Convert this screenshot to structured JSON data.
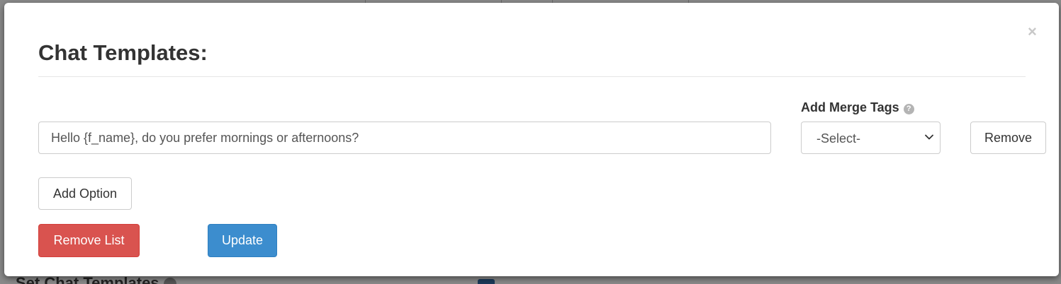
{
  "modal": {
    "title": "Chat Templates:",
    "close_label": "×",
    "merge_tags": {
      "label": "Add Merge Tags",
      "help_icon": "?",
      "select_value": "-Select-"
    },
    "option_input": {
      "value": "Hello {f_name}, do you prefer mornings or afternoons?"
    },
    "remove_label": "Remove",
    "add_option_label": "Add Option",
    "remove_list_label": "Remove List",
    "update_label": "Update"
  },
  "background": {
    "section_heading": "Set Chat Templates"
  },
  "colors": {
    "danger": "#d9534f",
    "primary": "#3c8dce",
    "overlay": "#8a8a8a"
  },
  "icons": {
    "close": "close-icon",
    "help": "question-circle-icon",
    "select_arrow": "chevron-down-icon"
  }
}
